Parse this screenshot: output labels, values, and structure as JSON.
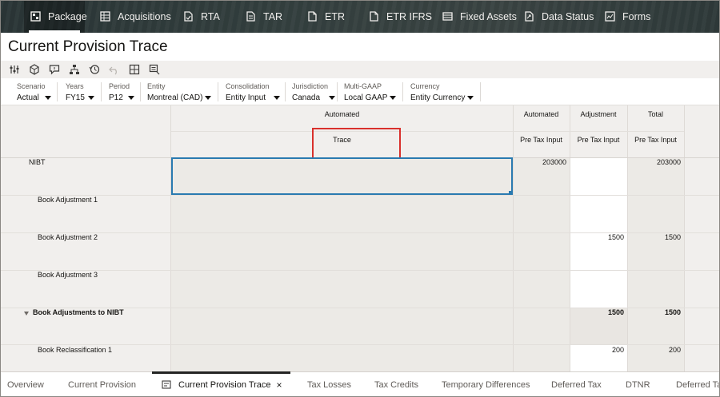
{
  "nav": {
    "items": [
      {
        "label": "Package",
        "icon": "package-icon",
        "active": true
      },
      {
        "label": "Acquisitions",
        "icon": "grid-icon"
      },
      {
        "label": "RTA",
        "icon": "document-check-icon"
      },
      {
        "label": "TAR",
        "icon": "document-edit-icon"
      },
      {
        "label": "ETR",
        "icon": "document-icon"
      },
      {
        "label": "ETR IFRS",
        "icon": "document-icon"
      },
      {
        "label": "Fixed Assets",
        "icon": "table-icon"
      },
      {
        "label": "Data Status",
        "icon": "document-share-icon"
      },
      {
        "label": "Forms",
        "icon": "chart-icon"
      }
    ]
  },
  "page": {
    "title": "Current Provision Trace"
  },
  "toolbar": {
    "buttons": [
      "sliders-icon",
      "cube-icon",
      "comment-icon",
      "hierarchy-icon",
      "history-icon",
      "undo-icon",
      "grid-layout-icon",
      "form-icon"
    ]
  },
  "pov": [
    {
      "label": "Scenario",
      "value": "Actual"
    },
    {
      "label": "Years",
      "value": "FY15"
    },
    {
      "label": "Period",
      "value": "P12"
    },
    {
      "label": "Entity",
      "value": "Montreal (CAD)"
    },
    {
      "label": "Consolidation",
      "value": "Entity Input"
    },
    {
      "label": "Jurisdiction",
      "value": "Canada"
    },
    {
      "label": "Multi-GAAP",
      "value": "Local GAAP"
    },
    {
      "label": "Currency",
      "value": "Entity Currency"
    }
  ],
  "grid": {
    "header1": [
      "Automated",
      "Automated",
      "Adjustment",
      "Total"
    ],
    "header2": [
      "Trace",
      "Pre Tax Input",
      "Pre Tax Input",
      "Pre Tax Input"
    ],
    "rows": [
      {
        "label": "NIBT",
        "automated": "203000",
        "adjustment": "",
        "total": "203000"
      },
      {
        "label": "Book Adjustment 1",
        "automated": "",
        "adjustment": "",
        "total": ""
      },
      {
        "label": "Book Adjustment 2",
        "automated": "",
        "adjustment": "1500",
        "total": "1500"
      },
      {
        "label": "Book Adjustment 3",
        "automated": "",
        "adjustment": "",
        "total": ""
      },
      {
        "label": "Book Adjustments to NIBT",
        "automated": "",
        "adjustment": "1500",
        "total": "1500"
      },
      {
        "label": "Book Reclassification 1",
        "automated": "",
        "adjustment": "200",
        "total": "200"
      }
    ]
  },
  "tabs": [
    {
      "label": "Overview"
    },
    {
      "label": "Current Provision"
    },
    {
      "label": "Current Provision Trace",
      "active": true,
      "close": "×"
    },
    {
      "label": "Tax Losses"
    },
    {
      "label": "Tax Credits"
    },
    {
      "label": "Temporary Differences"
    },
    {
      "label": "Deferred Tax"
    },
    {
      "label": "DTNR"
    },
    {
      "label": "Deferred Tax"
    }
  ],
  "colors": {
    "accent": "#2a7ab0",
    "highlight": "#d9302c",
    "nav_bg": "#313c3c"
  }
}
